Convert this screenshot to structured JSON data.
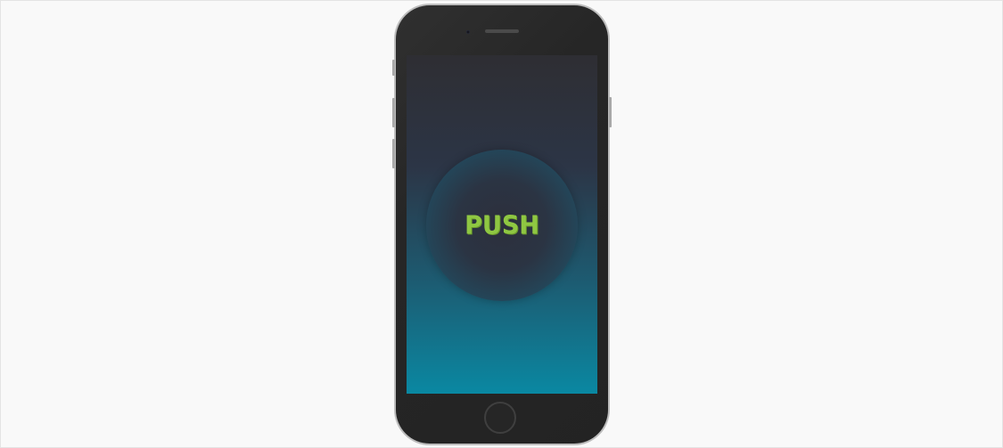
{
  "device": {
    "type": "smartphone",
    "frame_color": "#262626",
    "bezel_color": "#bdbdbd"
  },
  "screen": {
    "gradient_top": "#2e2e33",
    "gradient_bottom": "#0a88a2"
  },
  "push_button": {
    "label": "PUSH",
    "label_color": "#8fc742"
  },
  "icons": {
    "camera": "front-camera-icon",
    "speaker": "earpiece-speaker-icon",
    "home": "home-button-icon"
  }
}
